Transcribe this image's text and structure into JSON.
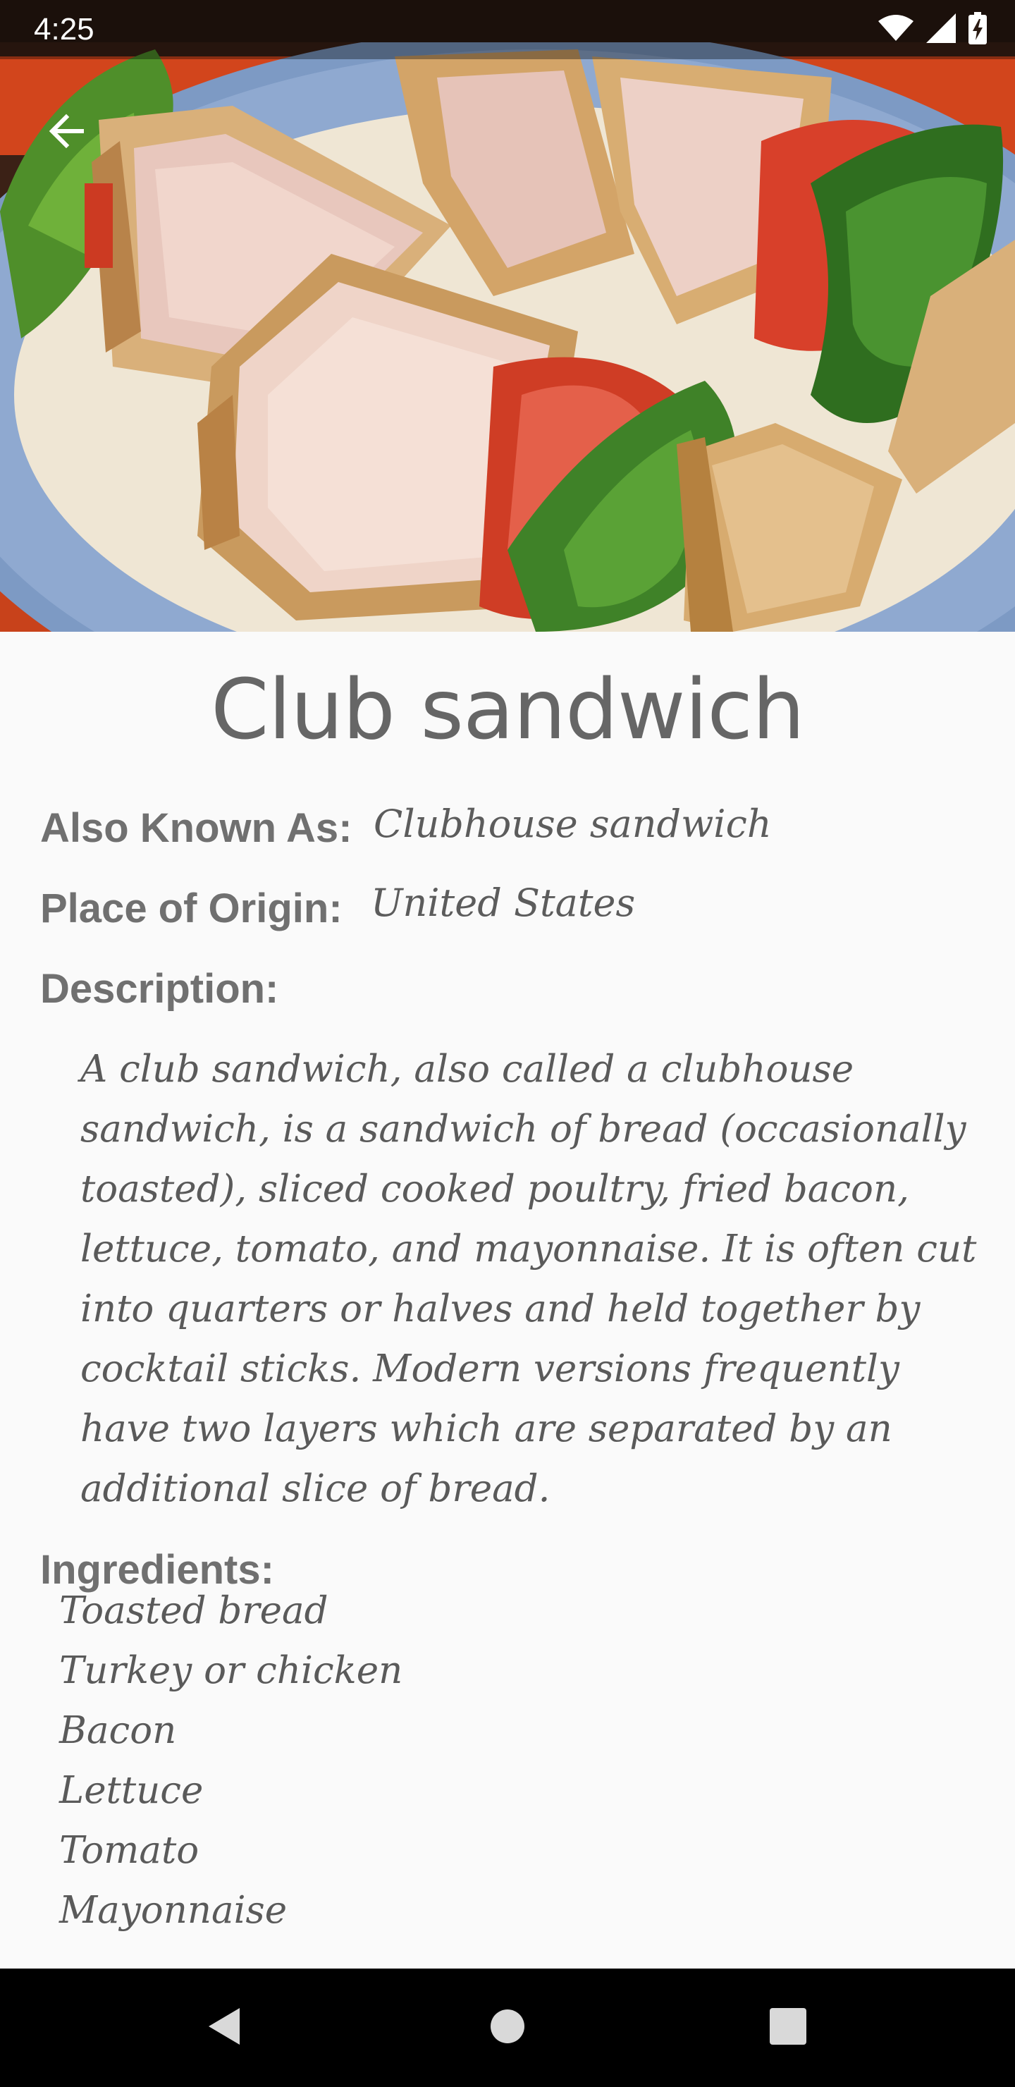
{
  "status_bar": {
    "time": "4:25",
    "icons": [
      "wifi-icon",
      "cellular-signal-icon",
      "battery-charging-icon"
    ]
  },
  "app_bar": {
    "back_icon": "arrow-back-icon"
  },
  "hero": {
    "image_subject": "club sandwich quarters on a blue-rimmed plate"
  },
  "dish": {
    "name": "Club sandwich",
    "also_known_as_label": "Also Known As:",
    "also_known_as": "Clubhouse sandwich",
    "place_of_origin_label": "Place of Origin:",
    "place_of_origin": "United States",
    "description_label": "Description:",
    "description": "A club sandwich, also called a clubhouse sandwich, is a sandwich of bread (occasionally toasted), sliced cooked poultry, fried bacon, lettuce, tomato, and mayonnaise. It is often cut into quarters or halves and held together by cocktail sticks. Modern versions frequently have two layers which are separated by an additional slice of bread.",
    "ingredients_label": "Ingredients:",
    "ingredients": [
      "Toasted bread",
      "Turkey or chicken",
      "Bacon",
      "Lettuce",
      "Tomato",
      "Mayonnaise"
    ]
  },
  "nav_bar": {
    "buttons": [
      "nav-back-icon",
      "nav-home-icon",
      "nav-recents-icon"
    ]
  },
  "colors": {
    "background": "#fafafa",
    "title_text": "#666666",
    "label_text": "#707070",
    "body_text": "#5a5a5a",
    "nav_bar": "#000000"
  }
}
